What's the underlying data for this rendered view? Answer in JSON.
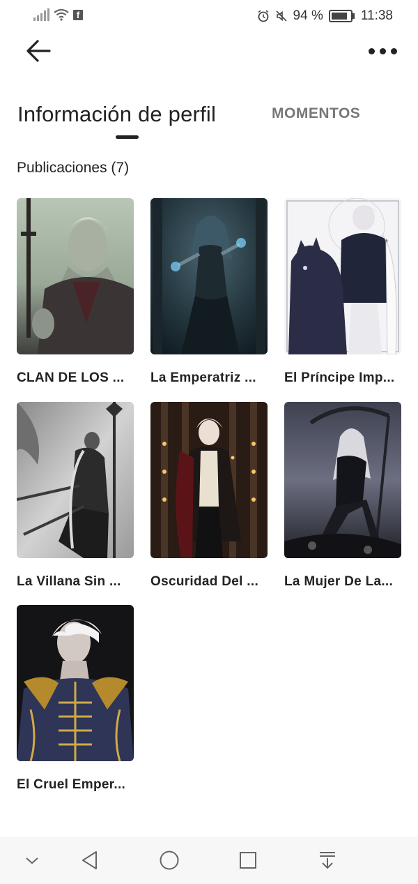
{
  "status_bar": {
    "battery_percent": "94 %",
    "time": "11:38",
    "icons": [
      "signal-icon",
      "wifi-icon",
      "facebook-icon",
      "alarm-icon",
      "mute-icon",
      "battery-icon"
    ]
  },
  "header": {
    "back_icon": "arrow-left-icon",
    "more_icon": "more-dots-icon"
  },
  "tabs": [
    {
      "label": "Información de perfil",
      "active": true
    },
    {
      "label": "MOMENTOS",
      "active": false
    }
  ],
  "publications": {
    "title": "Publicaciones (7)",
    "items": [
      {
        "title": "CLAN DE LOS ..."
      },
      {
        "title": "La Emperatriz ..."
      },
      {
        "title": "El Príncipe Imp..."
      },
      {
        "title": "La Villana Sin ..."
      },
      {
        "title": "Oscuridad Del ..."
      },
      {
        "title": "La Mujer De La..."
      },
      {
        "title": "El Cruel Emper..."
      }
    ]
  },
  "nav_bar": {
    "icons": [
      "collapse-chevron-icon",
      "back-triangle-icon",
      "home-circle-icon",
      "recents-square-icon",
      "notification-pull-icon"
    ]
  }
}
